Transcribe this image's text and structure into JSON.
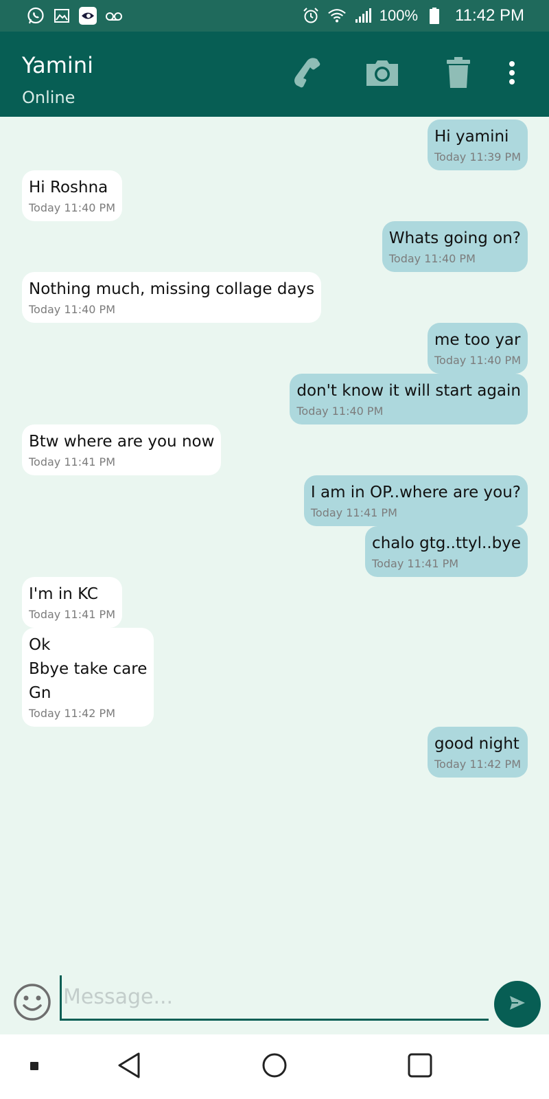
{
  "status_bar": {
    "battery_text": "100%",
    "time": "11:42 PM",
    "left_icons": [
      "whatsapp-icon",
      "image-icon",
      "app-icon",
      "voicemail-icon"
    ],
    "right_icons": [
      "alarm-icon",
      "wifi-icon",
      "signal-icon",
      "battery-icon"
    ]
  },
  "header": {
    "contact_name": "Yamini",
    "status": "Online",
    "actions": [
      "phone-icon",
      "camera-icon",
      "trash-icon",
      "more-vert-icon"
    ]
  },
  "messages": [
    {
      "side": "out",
      "lines": "Hi yamini",
      "time": "Today 11:39 PM"
    },
    {
      "side": "in",
      "lines": "Hi Roshna",
      "time": "Today 11:40 PM"
    },
    {
      "side": "out",
      "lines": "Whats going on?",
      "time": "Today 11:40 PM"
    },
    {
      "side": "in",
      "lines": "Nothing much, missing collage days",
      "time": "Today 11:40 PM"
    },
    {
      "side": "out",
      "lines": "me too yar",
      "time": "Today 11:40 PM"
    },
    {
      "side": "out",
      "lines": "don't know it will start again",
      "time": "Today 11:40 PM"
    },
    {
      "side": "in",
      "lines": "Btw where are you now",
      "time": "Today 11:41 PM"
    },
    {
      "side": "out",
      "lines": "I am in OP..where are you?",
      "time": "Today 11:41 PM"
    },
    {
      "side": "out",
      "lines": "chalo gtg..ttyl..bye",
      "time": "Today 11:41 PM"
    },
    {
      "side": "in",
      "lines": "I'm in KC",
      "time": "Today 11:41 PM"
    },
    {
      "side": "in",
      "lines": "Ok\nBbye take care\nGn",
      "time": "Today 11:42 PM"
    },
    {
      "side": "out",
      "lines": "good night",
      "time": "Today 11:42 PM"
    }
  ],
  "composer": {
    "placeholder": "Message...",
    "value": ""
  },
  "colors": {
    "status_bar": "#1f6a5c",
    "app_bar": "#075e54",
    "chat_bg": "#eaf6f0",
    "incoming_bubble": "#ffffff",
    "outgoing_bubble": "#add8dd"
  }
}
